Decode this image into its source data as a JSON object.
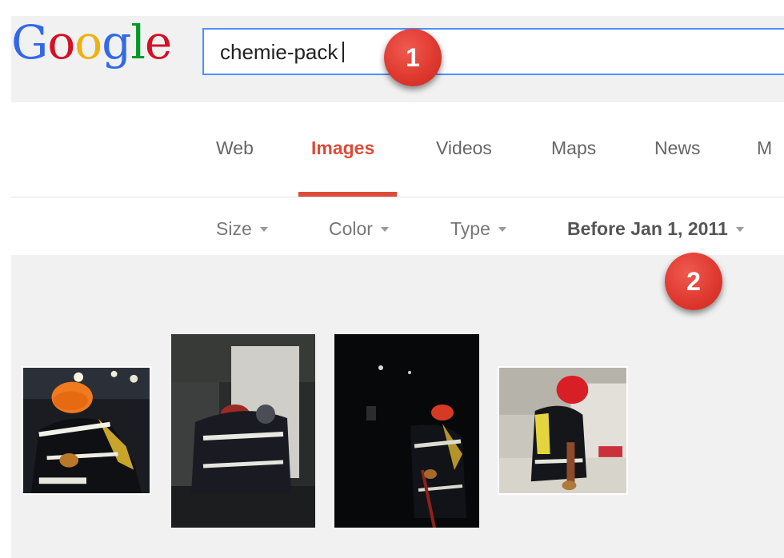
{
  "logo": {
    "letters": [
      "G",
      "o",
      "o",
      "g",
      "l",
      "e"
    ],
    "colors": [
      "#3369e8",
      "#d50f25",
      "#eeb211",
      "#3369e8",
      "#009925",
      "#d50f25"
    ]
  },
  "search": {
    "value": "chemie-pack"
  },
  "markers": {
    "step1": "1",
    "step2": "2"
  },
  "tabs": [
    {
      "label": "Web"
    },
    {
      "label": "Images"
    },
    {
      "label": "Videos"
    },
    {
      "label": "Maps"
    },
    {
      "label": "News"
    },
    {
      "label": "M"
    }
  ],
  "active_tab": "Images",
  "tools": [
    {
      "label": "Size"
    },
    {
      "label": "Color"
    },
    {
      "label": "Type"
    },
    {
      "label": "Before Jan 1, 2011"
    }
  ],
  "colors": {
    "accent_red": "#dd4b39",
    "search_border": "#4d90fe",
    "marker_red": "#e03a30"
  },
  "results": {
    "count": 4
  }
}
